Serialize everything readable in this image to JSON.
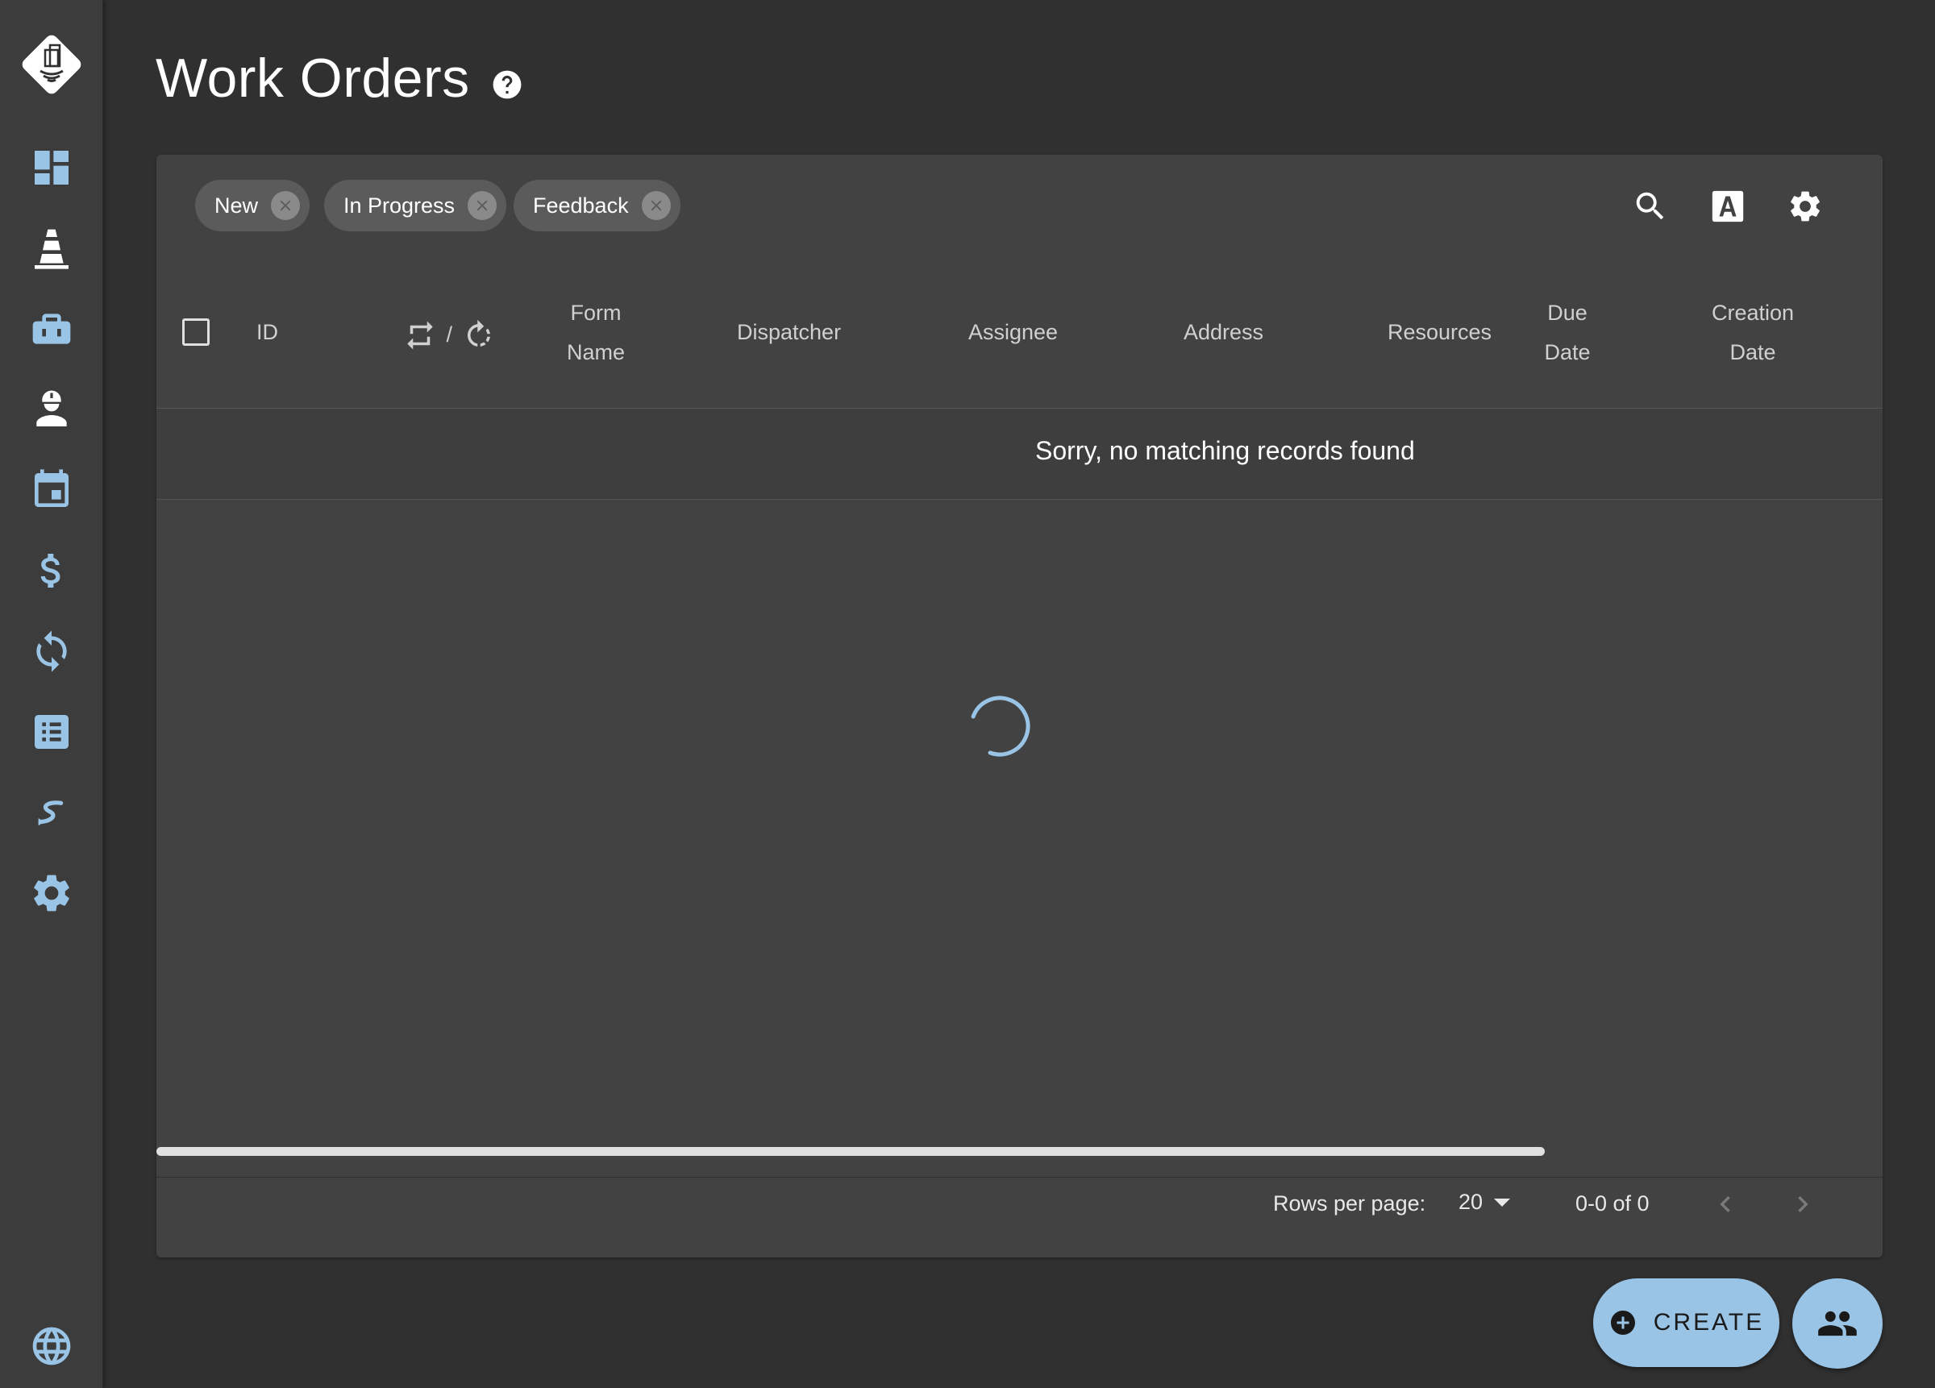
{
  "header": {
    "title": "Work Orders"
  },
  "sidebar": {
    "items": [
      {
        "icon": "dashboard-icon"
      },
      {
        "icon": "traffic-cone-icon"
      },
      {
        "icon": "toolbox-icon"
      },
      {
        "icon": "worker-icon"
      },
      {
        "icon": "calendar-icon"
      },
      {
        "icon": "dollar-icon"
      },
      {
        "icon": "sync-icon"
      },
      {
        "icon": "list-icon"
      },
      {
        "icon": "route-icon"
      },
      {
        "icon": "gear-icon"
      },
      {
        "icon": "globe-icon"
      }
    ]
  },
  "filters": {
    "chips": [
      {
        "label": "New"
      },
      {
        "label": "In Progress"
      },
      {
        "label": "Feedback"
      }
    ]
  },
  "table": {
    "columns": {
      "id": "ID",
      "recurrence_separator": "/",
      "form_name_1": "Form",
      "form_name_2": "Name",
      "dispatcher": "Dispatcher",
      "assignee": "Assignee",
      "address": "Address",
      "resources": "Resources",
      "due_date_1": "Due",
      "due_date_2": "Date",
      "creation_date_1": "Creation",
      "creation_date_2": "Date"
    },
    "empty_message": "Sorry, no matching records found"
  },
  "pagination": {
    "rows_per_page_label": "Rows per page:",
    "rows_per_page_value": "20",
    "range": "0-0 of 0"
  },
  "actions": {
    "create_label": "CREATE"
  },
  "colors": {
    "accent": "#9ac4e6",
    "background": "#303030",
    "card": "#424242",
    "sidebar": "#3c3c3c"
  }
}
